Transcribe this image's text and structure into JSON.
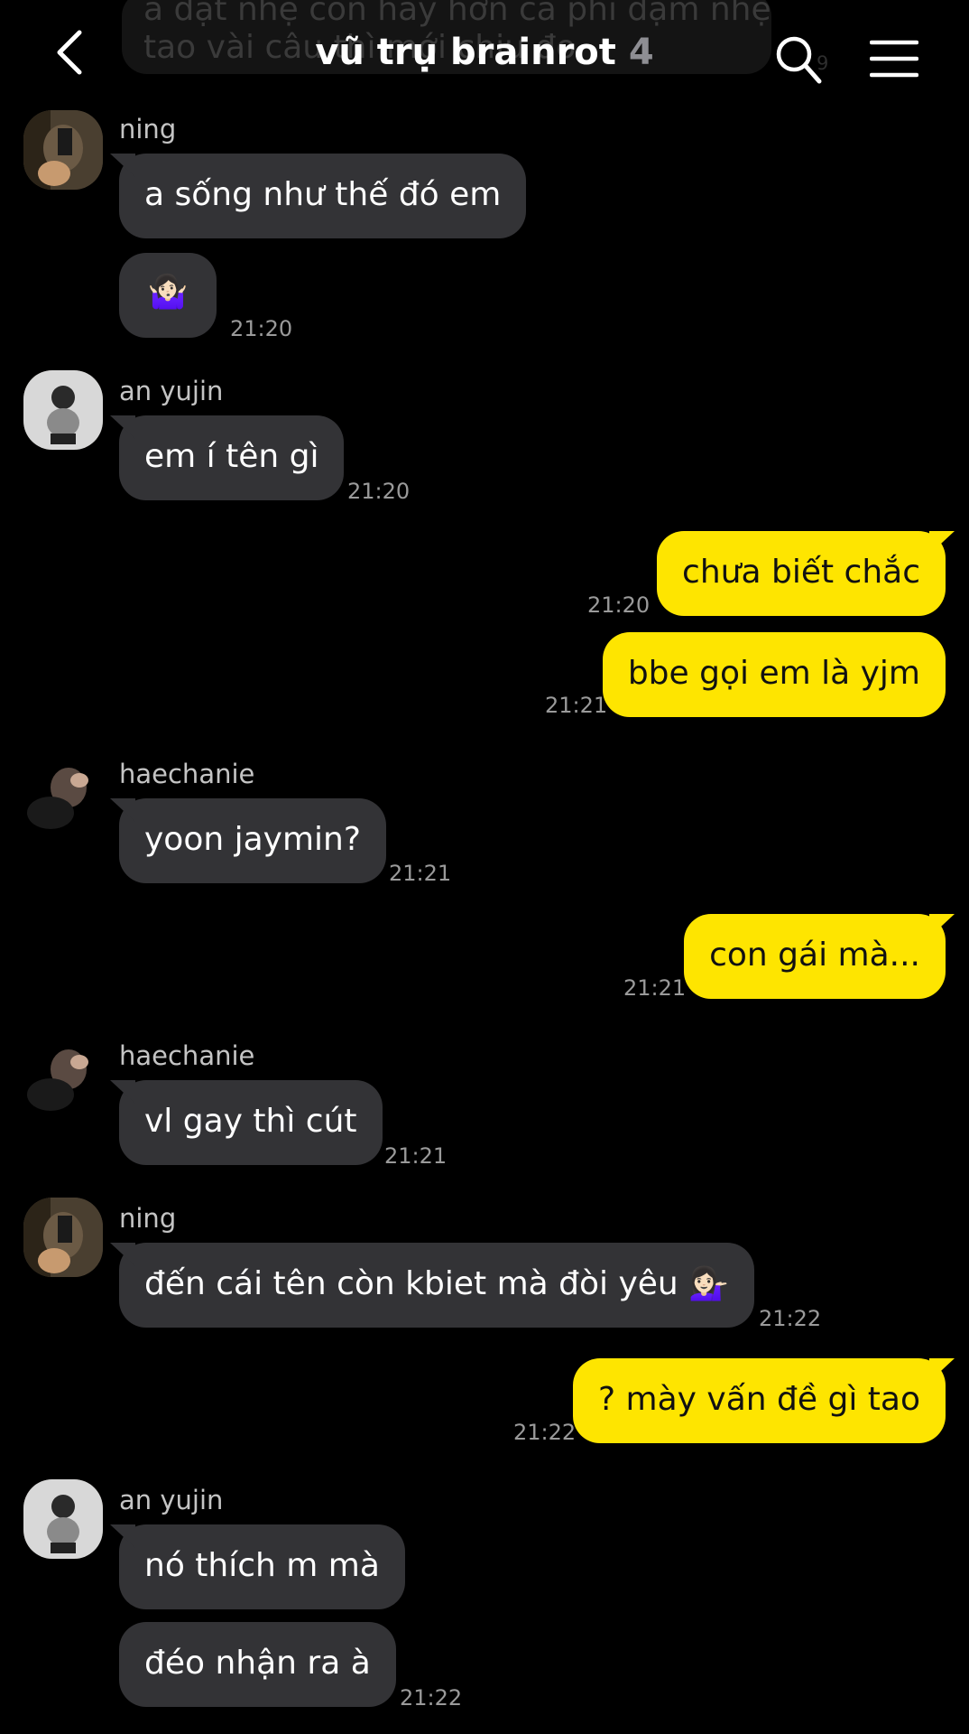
{
  "header": {
    "title": "vũ trụ brainrot",
    "member_count": "4"
  },
  "ghost": {
    "line1": "a đặt nhẹ con hay hơn cả phi đạm nhẹt",
    "line2": "tao vài câu thì mới chịu đo",
    "time": "9"
  },
  "messages": [
    {
      "sender": "ning",
      "text": "a sống như thế đó em"
    },
    {
      "text": "🤷🏻‍♀️",
      "time": "21:20"
    },
    {
      "sender": "an yujin",
      "text": "em í tên gì",
      "time": "21:20"
    },
    {
      "text": "chưa biết chắc",
      "time": "21:20",
      "mine": true
    },
    {
      "text": "bbe gọi em là yjm",
      "time": "21:21",
      "mine": true
    },
    {
      "sender": "haechanie",
      "text": "yoon jaymin?",
      "time": "21:21"
    },
    {
      "text": "con gái mà...",
      "time": "21:21",
      "mine": true
    },
    {
      "sender": "haechanie",
      "text": "vl gay thì cút",
      "time": "21:21"
    },
    {
      "sender": "ning",
      "text": "đến cái tên còn kbiet mà đòi yêu 💁🏻‍♀️",
      "time": "21:22"
    },
    {
      "text": "? mày vấn đề gì tao",
      "time": "21:22",
      "mine": true
    },
    {
      "sender": "an yujin",
      "text": "nó thích m mà"
    },
    {
      "text": "đéo nhận ra à",
      "time": "21:22"
    }
  ],
  "colors": {
    "background": "#000000",
    "incoming_bubble": "#333336",
    "outgoing_bubble": "#fee500"
  },
  "icons": [
    "back-chevron-icon",
    "search-icon",
    "menu-icon"
  ]
}
